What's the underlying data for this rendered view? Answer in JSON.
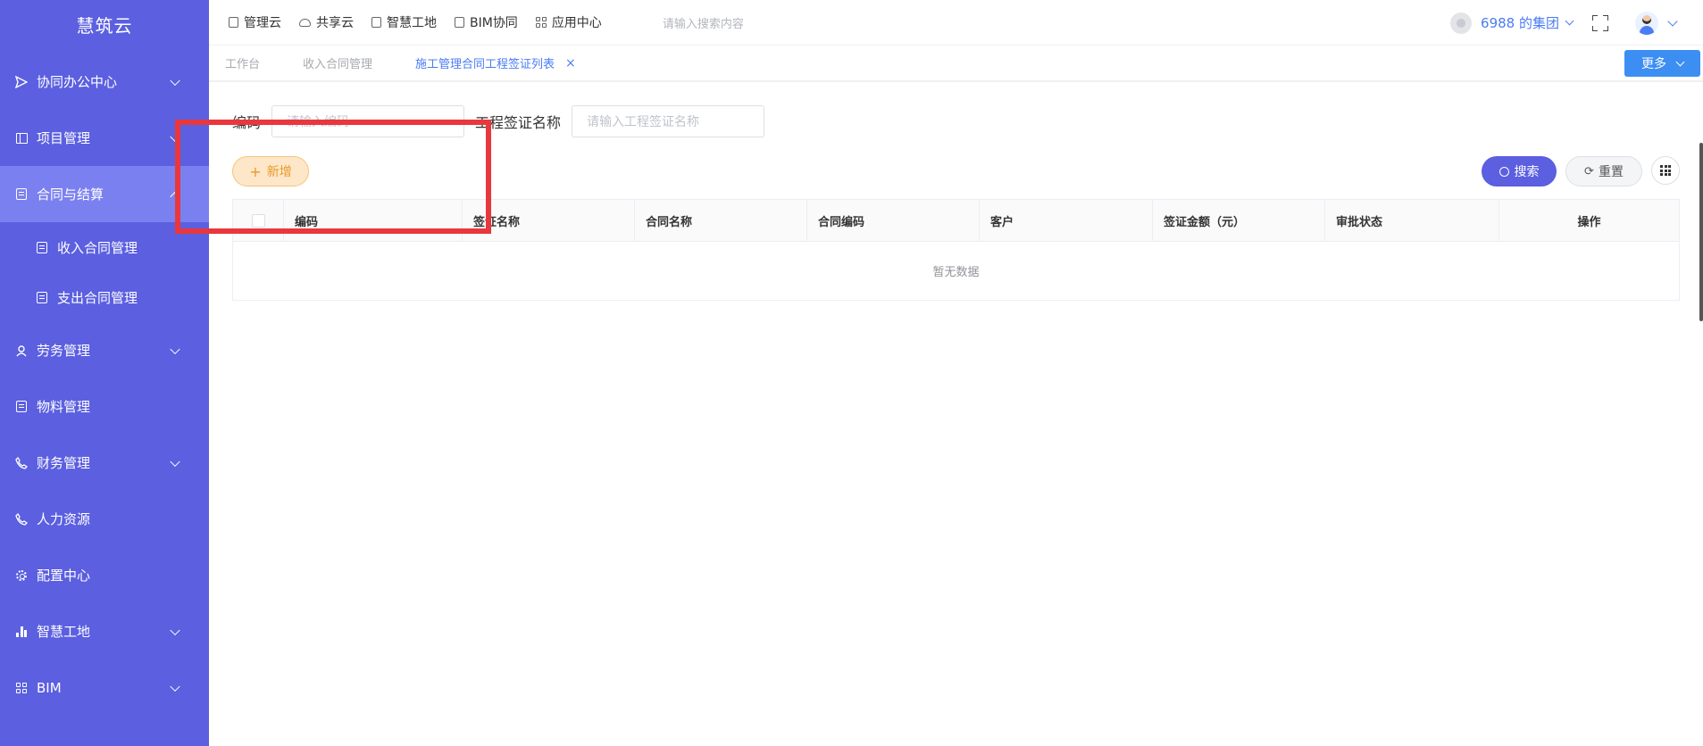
{
  "brand": "慧筑云",
  "sidebar": {
    "items": [
      {
        "label": "协同办公中心",
        "icon": "send-icon",
        "expandable": true
      },
      {
        "label": "项目管理",
        "icon": "book-icon",
        "expandable": true
      },
      {
        "label": "合同与结算",
        "icon": "edit-doc-icon",
        "expandable": true,
        "expanded": true
      },
      {
        "label": "劳务管理",
        "icon": "worker-icon",
        "expandable": true
      },
      {
        "label": "物料管理",
        "icon": "edit-doc-icon",
        "expandable": false
      },
      {
        "label": "财务管理",
        "icon": "phone-icon",
        "expandable": true
      },
      {
        "label": "人力资源",
        "icon": "phone-icon",
        "expandable": false
      },
      {
        "label": "配置中心",
        "icon": "gear-icon",
        "expandable": false
      },
      {
        "label": "智慧工地",
        "icon": "bar-chart-icon",
        "expandable": true
      },
      {
        "label": "BIM",
        "icon": "grid-icon",
        "expandable": true
      }
    ],
    "subitems": [
      {
        "label": "收入合同管理",
        "icon": "edit-doc-icon"
      },
      {
        "label": "支出合同管理",
        "icon": "edit-doc-icon"
      }
    ]
  },
  "topnav": {
    "items": [
      {
        "label": "管理云",
        "icon": "doc-icon"
      },
      {
        "label": "共享云",
        "icon": "cloud-icon"
      },
      {
        "label": "智慧工地",
        "icon": "doc-icon"
      },
      {
        "label": "BIM协同",
        "icon": "cube-icon"
      },
      {
        "label": "应用中心",
        "icon": "grid-icon"
      }
    ],
    "search_placeholder": "请输入搜索内容",
    "org_name": "6988 的集团"
  },
  "tabs": {
    "items": [
      {
        "label": "工作台",
        "active": false
      },
      {
        "label": "收入合同管理",
        "active": false
      },
      {
        "label": "施工管理合同工程签证列表",
        "active": true
      }
    ],
    "close_symbol": "×",
    "more_label": "更多"
  },
  "filters": {
    "code_label": "编码",
    "code_placeholder": "请输入编码",
    "name_label": "工程签证名称",
    "name_placeholder": "请输入工程签证名称"
  },
  "actions": {
    "add_label": "新增",
    "search_label": "搜索",
    "reset_label": "重置"
  },
  "table": {
    "columns": [
      "编码",
      "签证名称",
      "合同名称",
      "合同编码",
      "客户",
      "签证金额（元）",
      "审批状态",
      "操作"
    ],
    "empty_text": "暂无数据"
  },
  "colors": {
    "sidebar_bg": "#5b5fe0",
    "sidebar_active": "#7b80f0",
    "accent_blue": "#4a7cf4",
    "add_orange": "#e89a2c",
    "highlight_red": "#e8383d"
  }
}
